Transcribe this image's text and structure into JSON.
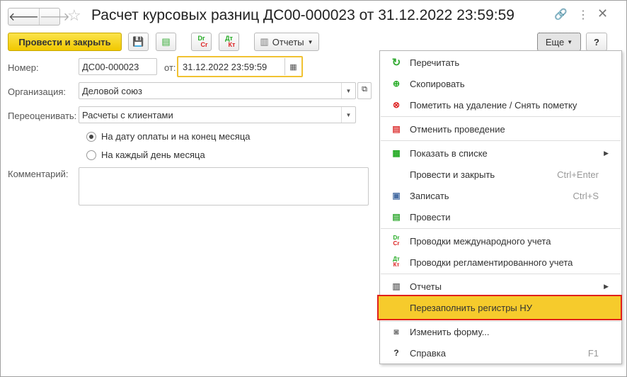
{
  "title": "Расчет курсовых разниц ДС00-000023 от 31.12.2022 23:59:59",
  "toolbar": {
    "post_close": "Провести и закрыть",
    "reports": "Отчеты",
    "more": "Еще",
    "help": "?",
    "dr": "Dr",
    "cr": "Cr",
    "dt": "Дт",
    "kt": "Кт"
  },
  "form": {
    "number_label": "Номер:",
    "number": "ДС00-000023",
    "date_label": "от:",
    "date": "31.12.2022 23:59:59",
    "org_label": "Организация:",
    "org": "Деловой союз",
    "reval_label": "Переоценивать:",
    "reval": "Расчеты с клиентами",
    "radio1": "На дату оплаты и на конец месяца",
    "radio2": "На каждый день месяца",
    "comment_label": "Комментарий:",
    "comment": ""
  },
  "menu": [
    {
      "label": "Перечитать",
      "icon": "refresh-icon"
    },
    {
      "label": "Скопировать",
      "icon": "copy-icon"
    },
    {
      "label": "Пометить на удаление / Снять пометку",
      "icon": "delete-mark-icon"
    },
    {
      "label": "Отменить проведение",
      "icon": "unpost-icon"
    },
    {
      "label": "Показать в списке",
      "icon": "show-in-list-icon"
    },
    {
      "label": "Провести и закрыть",
      "shortcut": "Ctrl+Enter"
    },
    {
      "label": "Записать",
      "shortcut": "Ctrl+S",
      "icon": "save-icon"
    },
    {
      "label": "Провести",
      "icon": "post-icon"
    },
    {
      "label": "Проводки международного учета",
      "icon": "dr-cr-icon"
    },
    {
      "label": "Проводки регламентированного учета",
      "icon": "dt-kt-icon"
    },
    {
      "label": "Отчеты",
      "icon": "reports-icon"
    },
    {
      "label": "Перезаполнить регистры НУ"
    },
    {
      "label": "Изменить форму...",
      "icon": "form-icon"
    },
    {
      "label": "Справка",
      "shortcut": "F1",
      "icon": "help-icon"
    }
  ],
  "colors": {
    "accent": "#f1c800",
    "highlight": "#f6cb2c",
    "highlight_border": "#e0201a"
  }
}
